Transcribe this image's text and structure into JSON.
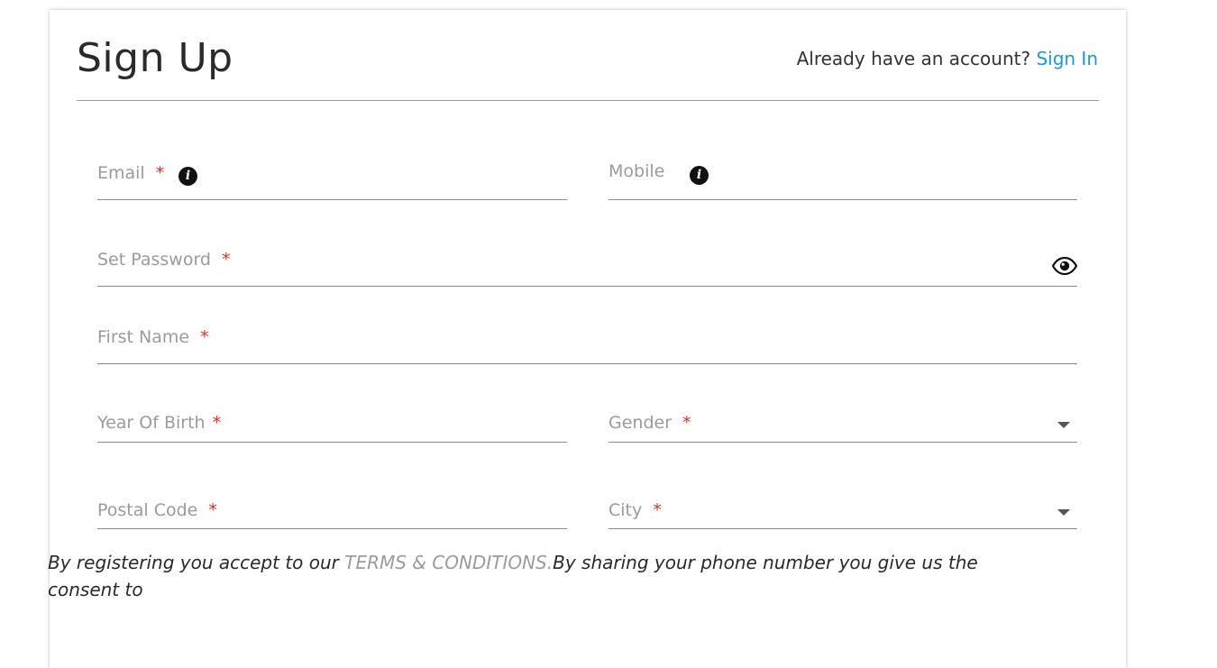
{
  "header": {
    "title": "Sign Up",
    "already_text": "Already have an account?",
    "signin_link": "Sign In"
  },
  "form": {
    "email": {
      "label": "Email",
      "required": "*"
    },
    "mobile": {
      "label": "Mobile"
    },
    "password": {
      "label": "Set Password",
      "required": "*"
    },
    "first_name": {
      "label": "First Name",
      "required": "*"
    },
    "year_of_birth": {
      "label": "Year Of Birth",
      "required": "*"
    },
    "gender": {
      "label": "Gender",
      "required": "*"
    },
    "postal_code": {
      "label": "Postal Code",
      "required": "*"
    },
    "city": {
      "label": "City",
      "required": "*"
    }
  },
  "terms": {
    "prefix": "By registering you accept to our ",
    "link": "TERMS & CONDITIONS.",
    "suffix": "By sharing your phone number you give us the consent to"
  },
  "colors": {
    "link": "#1a9ad6",
    "required": "#d93025",
    "label": "#9b9b9b"
  },
  "icons": {
    "info": "info-icon",
    "eye": "eye-icon",
    "dropdown": "caret-down-icon"
  }
}
